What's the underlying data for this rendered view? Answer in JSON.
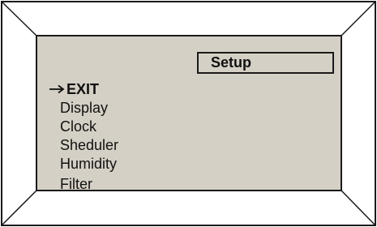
{
  "screen": {
    "title": "Setup",
    "menu": [
      {
        "label": "EXIT",
        "selected": true,
        "icon": "right-arrow-icon"
      },
      {
        "label": "Display",
        "selected": false
      },
      {
        "label": "Clock",
        "selected": false
      },
      {
        "label": "Sheduler",
        "selected": false
      },
      {
        "label": "Humidity",
        "selected": false
      },
      {
        "label": "Filter",
        "selected": false
      }
    ]
  },
  "colors": {
    "screen_background": "#d5d0c5",
    "outline": "#1a1a1a",
    "text": "#111111"
  }
}
